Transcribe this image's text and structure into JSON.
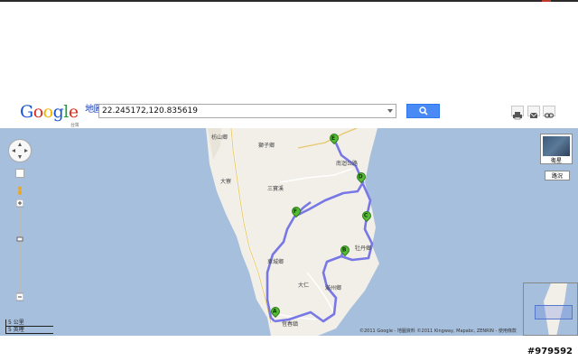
{
  "header": {
    "logo_text": "Google",
    "logo_sub": "地圖",
    "logo_region": "台灣",
    "search_value": "22.245172,120.835619"
  },
  "map_controls": {
    "satellite_label": "衛星",
    "traffic_label": "路況",
    "scale_metric": "5 公里",
    "scale_imperial": "5 英哩"
  },
  "map_labels": {
    "town_north": "枋山鄉",
    "town_shizi": "獅子鄉",
    "town_mudan": "牡丹鄉",
    "town_checheng": "車城鄉",
    "town_manzhou": "滿州鄉",
    "town_hengchun": "恆春鎮",
    "village_dajia": "大寮",
    "village_daren": "大仁",
    "village_sanbao": "三寶溪",
    "road_label": "南迴公路"
  },
  "markers": [
    "E",
    "D",
    "C",
    "F",
    "B",
    "A"
  ],
  "copyright": "©2011 Google - 地圖資料 ©2011 Kingway, Mapabc, ZENRIN - 使用條款",
  "watermark": "#979592",
  "colors": {
    "water": "#a6bfdd",
    "land": "#f2efe9",
    "route": "#7777e6",
    "marker": "#55bb33",
    "search_button": "#4a8af4"
  }
}
